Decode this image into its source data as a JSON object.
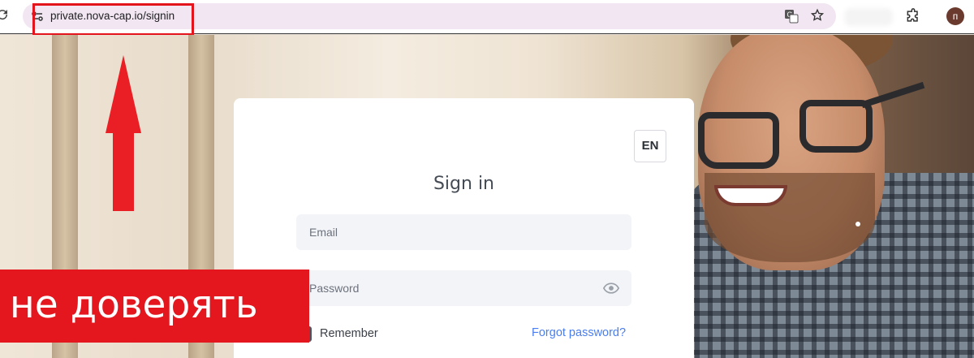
{
  "browser": {
    "url": "private.nova-cap.io/signin",
    "avatar_letter": "п"
  },
  "signin": {
    "language": "EN",
    "title": "Sign in",
    "email_placeholder": "Email",
    "password_placeholder": "Password",
    "remember_label": "Remember",
    "forgot_label": "Forgot password?"
  },
  "annotation": {
    "warning_text": "не доверять",
    "accent_color": "#e4171f"
  },
  "icons": {
    "reload": "reload-icon",
    "site_info": "site-info-icon",
    "translate": "translate-icon",
    "bookmark": "star-icon",
    "extensions": "extensions-icon",
    "show_password": "eye-icon"
  }
}
